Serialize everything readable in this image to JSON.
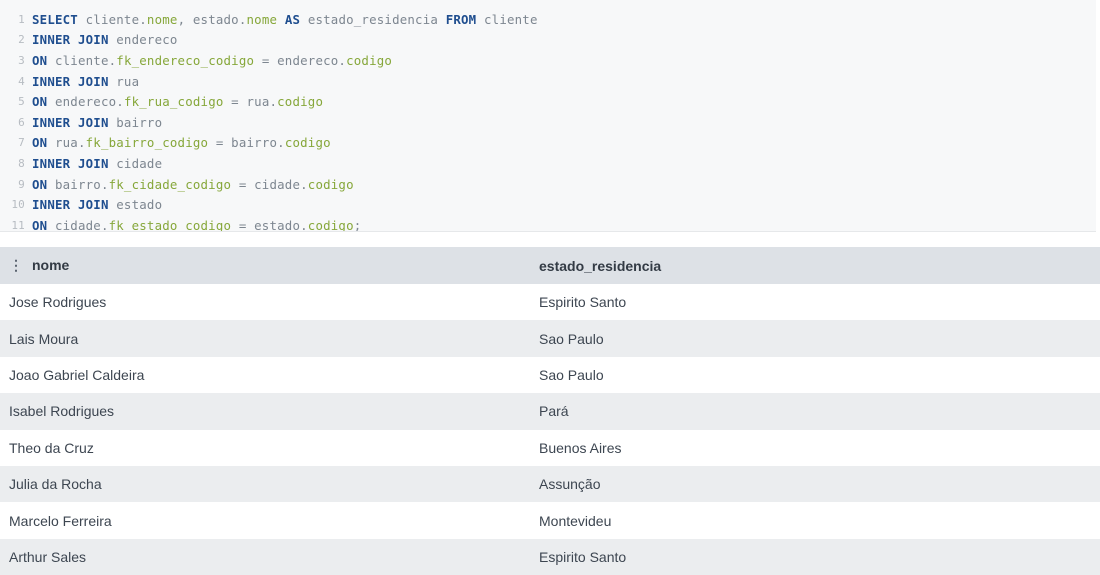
{
  "editor": {
    "lines": [
      {
        "n": "1",
        "tokens": [
          {
            "t": "SELECT",
            "c": "kw"
          },
          {
            "t": " cliente.",
            "c": "id"
          },
          {
            "t": "nome",
            "c": "prop"
          },
          {
            "t": ", estado.",
            "c": "id"
          },
          {
            "t": "nome",
            "c": "prop"
          },
          {
            "t": " ",
            "c": "id"
          },
          {
            "t": "AS",
            "c": "kw"
          },
          {
            "t": " estado_residencia ",
            "c": "id"
          },
          {
            "t": "FROM",
            "c": "kw"
          },
          {
            "t": " cliente",
            "c": "id"
          }
        ]
      },
      {
        "n": "2",
        "tokens": [
          {
            "t": "INNER JOIN",
            "c": "kw"
          },
          {
            "t": " endereco",
            "c": "id"
          }
        ]
      },
      {
        "n": "3",
        "tokens": [
          {
            "t": "ON",
            "c": "kw"
          },
          {
            "t": " cliente.",
            "c": "id"
          },
          {
            "t": "fk_endereco_codigo",
            "c": "prop"
          },
          {
            "t": " = endereco.",
            "c": "id"
          },
          {
            "t": "codigo",
            "c": "prop"
          }
        ]
      },
      {
        "n": "4",
        "tokens": [
          {
            "t": "INNER JOIN",
            "c": "kw"
          },
          {
            "t": " rua",
            "c": "id"
          }
        ]
      },
      {
        "n": "5",
        "tokens": [
          {
            "t": "ON",
            "c": "kw"
          },
          {
            "t": " endereco.",
            "c": "id"
          },
          {
            "t": "fk_rua_codigo",
            "c": "prop"
          },
          {
            "t": " = rua.",
            "c": "id"
          },
          {
            "t": "codigo",
            "c": "prop"
          }
        ]
      },
      {
        "n": "6",
        "tokens": [
          {
            "t": "INNER JOIN",
            "c": "kw"
          },
          {
            "t": " bairro",
            "c": "id"
          }
        ]
      },
      {
        "n": "7",
        "tokens": [
          {
            "t": "ON",
            "c": "kw"
          },
          {
            "t": " rua.",
            "c": "id"
          },
          {
            "t": "fk_bairro_codigo",
            "c": "prop"
          },
          {
            "t": " = bairro.",
            "c": "id"
          },
          {
            "t": "codigo",
            "c": "prop"
          }
        ]
      },
      {
        "n": "8",
        "tokens": [
          {
            "t": "INNER JOIN",
            "c": "kw"
          },
          {
            "t": " cidade",
            "c": "id"
          }
        ]
      },
      {
        "n": "9",
        "tokens": [
          {
            "t": "ON",
            "c": "kw"
          },
          {
            "t": " bairro.",
            "c": "id"
          },
          {
            "t": "fk_cidade_codigo",
            "c": "prop"
          },
          {
            "t": " = cidade.",
            "c": "id"
          },
          {
            "t": "codigo",
            "c": "prop"
          }
        ]
      },
      {
        "n": "10",
        "tokens": [
          {
            "t": "INNER JOIN",
            "c": "kw"
          },
          {
            "t": " estado",
            "c": "id"
          }
        ]
      },
      {
        "n": "11",
        "tokens": [
          {
            "t": "ON",
            "c": "kw"
          },
          {
            "t": " cidade.",
            "c": "id"
          },
          {
            "t": "fk_estado_codigo",
            "c": "prop"
          },
          {
            "t": " = estado.",
            "c": "id"
          },
          {
            "t": "codigo",
            "c": "prop"
          },
          {
            "t": ";",
            "c": "id"
          }
        ]
      }
    ]
  },
  "results": {
    "headers": [
      "nome",
      "estado_residencia"
    ],
    "header_icon": "kebab-menu-icon",
    "rows": [
      [
        "Jose Rodrigues",
        "Espirito Santo"
      ],
      [
        "Lais Moura",
        "Sao Paulo"
      ],
      [
        "Joao Gabriel Caldeira",
        "Sao Paulo"
      ],
      [
        "Isabel Rodrigues",
        "Pará"
      ],
      [
        "Theo da Cruz",
        "Buenos Aires"
      ],
      [
        "Julia da Rocha",
        "Assunção"
      ],
      [
        "Marcelo Ferreira",
        "Montevideu"
      ],
      [
        "Arthur Sales",
        "Espirito Santo"
      ]
    ]
  },
  "colors": {
    "keyword": "#1f4e8f",
    "property": "#86a73a",
    "identifier": "#7d8690",
    "header_bg": "#dde1e6",
    "row_alt_bg": "#ebedef"
  }
}
